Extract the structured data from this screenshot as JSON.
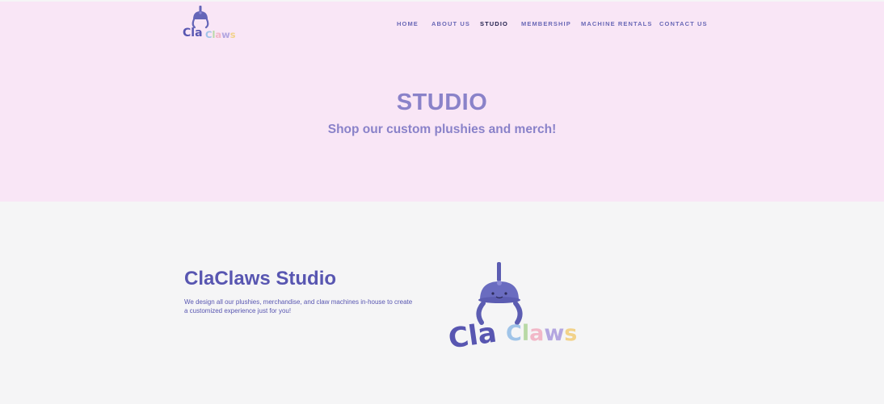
{
  "header": {
    "logo_text_left": "Cla",
    "logo_text_right": "Claws",
    "nav": [
      {
        "label": "HOME"
      },
      {
        "label": "ABOUT US"
      },
      {
        "label": "STUDIO"
      },
      {
        "label": "MEMBERSHIP"
      },
      {
        "label": "MACHINE RENTALS"
      },
      {
        "label": "CONTACT US"
      }
    ],
    "active_nav": "STUDIO"
  },
  "hero": {
    "title": "STUDIO",
    "subtitle": "Shop our custom plushies and merch!"
  },
  "studio": {
    "title": "ClaClaws Studio",
    "description": "We design all our plushies, merchandise, and claw machines in-house to create a customized experience just for you!"
  },
  "colors": {
    "hero_bg": "#f9e6f6",
    "page_bg": "#f5f5f6",
    "primary": "#5856b1",
    "hero_text": "#8a82c9",
    "nav_text": "#6a68b6",
    "nav_active": "#1f1d4a"
  },
  "icons": {
    "logo": "claw-machine-logo-icon",
    "studio_image": "claclaws-claw-logo-icon"
  }
}
